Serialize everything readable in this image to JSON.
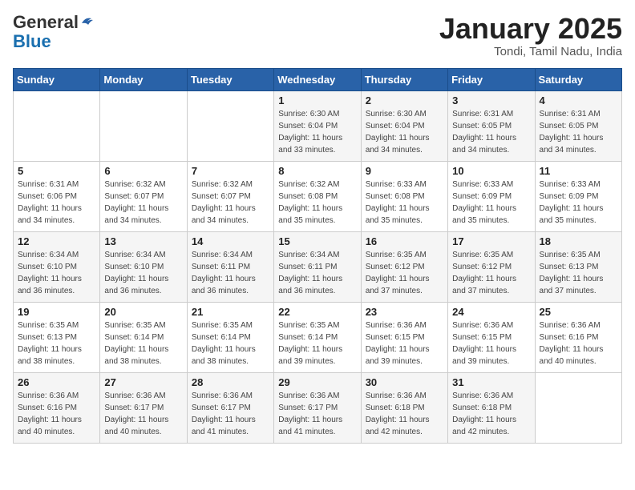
{
  "logo": {
    "general": "General",
    "blue": "Blue"
  },
  "title": "January 2025",
  "subtitle": "Tondi, Tamil Nadu, India",
  "days_of_week": [
    "Sunday",
    "Monday",
    "Tuesday",
    "Wednesday",
    "Thursday",
    "Friday",
    "Saturday"
  ],
  "weeks": [
    [
      {
        "day": "",
        "info": ""
      },
      {
        "day": "",
        "info": ""
      },
      {
        "day": "",
        "info": ""
      },
      {
        "day": "1",
        "info": "Sunrise: 6:30 AM\nSunset: 6:04 PM\nDaylight: 11 hours\nand 33 minutes."
      },
      {
        "day": "2",
        "info": "Sunrise: 6:30 AM\nSunset: 6:04 PM\nDaylight: 11 hours\nand 34 minutes."
      },
      {
        "day": "3",
        "info": "Sunrise: 6:31 AM\nSunset: 6:05 PM\nDaylight: 11 hours\nand 34 minutes."
      },
      {
        "day": "4",
        "info": "Sunrise: 6:31 AM\nSunset: 6:05 PM\nDaylight: 11 hours\nand 34 minutes."
      }
    ],
    [
      {
        "day": "5",
        "info": "Sunrise: 6:31 AM\nSunset: 6:06 PM\nDaylight: 11 hours\nand 34 minutes."
      },
      {
        "day": "6",
        "info": "Sunrise: 6:32 AM\nSunset: 6:07 PM\nDaylight: 11 hours\nand 34 minutes."
      },
      {
        "day": "7",
        "info": "Sunrise: 6:32 AM\nSunset: 6:07 PM\nDaylight: 11 hours\nand 34 minutes."
      },
      {
        "day": "8",
        "info": "Sunrise: 6:32 AM\nSunset: 6:08 PM\nDaylight: 11 hours\nand 35 minutes."
      },
      {
        "day": "9",
        "info": "Sunrise: 6:33 AM\nSunset: 6:08 PM\nDaylight: 11 hours\nand 35 minutes."
      },
      {
        "day": "10",
        "info": "Sunrise: 6:33 AM\nSunset: 6:09 PM\nDaylight: 11 hours\nand 35 minutes."
      },
      {
        "day": "11",
        "info": "Sunrise: 6:33 AM\nSunset: 6:09 PM\nDaylight: 11 hours\nand 35 minutes."
      }
    ],
    [
      {
        "day": "12",
        "info": "Sunrise: 6:34 AM\nSunset: 6:10 PM\nDaylight: 11 hours\nand 36 minutes."
      },
      {
        "day": "13",
        "info": "Sunrise: 6:34 AM\nSunset: 6:10 PM\nDaylight: 11 hours\nand 36 minutes."
      },
      {
        "day": "14",
        "info": "Sunrise: 6:34 AM\nSunset: 6:11 PM\nDaylight: 11 hours\nand 36 minutes."
      },
      {
        "day": "15",
        "info": "Sunrise: 6:34 AM\nSunset: 6:11 PM\nDaylight: 11 hours\nand 36 minutes."
      },
      {
        "day": "16",
        "info": "Sunrise: 6:35 AM\nSunset: 6:12 PM\nDaylight: 11 hours\nand 37 minutes."
      },
      {
        "day": "17",
        "info": "Sunrise: 6:35 AM\nSunset: 6:12 PM\nDaylight: 11 hours\nand 37 minutes."
      },
      {
        "day": "18",
        "info": "Sunrise: 6:35 AM\nSunset: 6:13 PM\nDaylight: 11 hours\nand 37 minutes."
      }
    ],
    [
      {
        "day": "19",
        "info": "Sunrise: 6:35 AM\nSunset: 6:13 PM\nDaylight: 11 hours\nand 38 minutes."
      },
      {
        "day": "20",
        "info": "Sunrise: 6:35 AM\nSunset: 6:14 PM\nDaylight: 11 hours\nand 38 minutes."
      },
      {
        "day": "21",
        "info": "Sunrise: 6:35 AM\nSunset: 6:14 PM\nDaylight: 11 hours\nand 38 minutes."
      },
      {
        "day": "22",
        "info": "Sunrise: 6:35 AM\nSunset: 6:14 PM\nDaylight: 11 hours\nand 39 minutes."
      },
      {
        "day": "23",
        "info": "Sunrise: 6:36 AM\nSunset: 6:15 PM\nDaylight: 11 hours\nand 39 minutes."
      },
      {
        "day": "24",
        "info": "Sunrise: 6:36 AM\nSunset: 6:15 PM\nDaylight: 11 hours\nand 39 minutes."
      },
      {
        "day": "25",
        "info": "Sunrise: 6:36 AM\nSunset: 6:16 PM\nDaylight: 11 hours\nand 40 minutes."
      }
    ],
    [
      {
        "day": "26",
        "info": "Sunrise: 6:36 AM\nSunset: 6:16 PM\nDaylight: 11 hours\nand 40 minutes."
      },
      {
        "day": "27",
        "info": "Sunrise: 6:36 AM\nSunset: 6:17 PM\nDaylight: 11 hours\nand 40 minutes."
      },
      {
        "day": "28",
        "info": "Sunrise: 6:36 AM\nSunset: 6:17 PM\nDaylight: 11 hours\nand 41 minutes."
      },
      {
        "day": "29",
        "info": "Sunrise: 6:36 AM\nSunset: 6:17 PM\nDaylight: 11 hours\nand 41 minutes."
      },
      {
        "day": "30",
        "info": "Sunrise: 6:36 AM\nSunset: 6:18 PM\nDaylight: 11 hours\nand 42 minutes."
      },
      {
        "day": "31",
        "info": "Sunrise: 6:36 AM\nSunset: 6:18 PM\nDaylight: 11 hours\nand 42 minutes."
      },
      {
        "day": "",
        "info": ""
      }
    ]
  ]
}
